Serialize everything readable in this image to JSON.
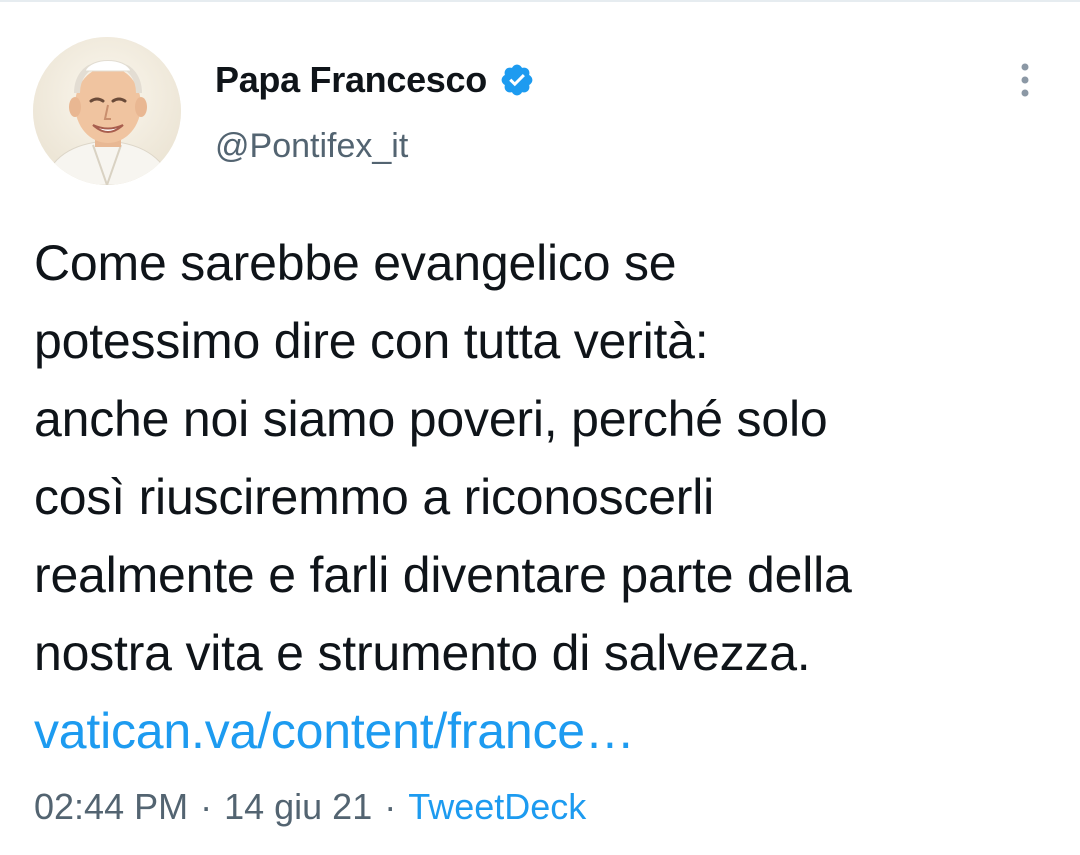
{
  "tweet": {
    "author": {
      "display_name": "Papa Francesco",
      "handle": "@Pontifex_it",
      "verified": true,
      "avatar_icon": "profile-photo"
    },
    "text_lines": [
      "Come sarebbe evangelico se",
      "potessimo dire con tutta verità:",
      "anche noi siamo poveri, perché solo",
      "così riusciremmo a riconoscerli",
      "realmente e farli diventare parte della",
      "nostra vita e strumento di salvezza."
    ],
    "link_text": "vatican.va/content/france…",
    "time": "02:44 PM",
    "separator": "·",
    "date": "14 giu 21",
    "source": "TweetDeck"
  },
  "icons": {
    "verified": "verified-badge-icon",
    "more": "more-vertical-icon"
  },
  "colors": {
    "text": "#0f1419",
    "secondary": "#536471",
    "accent": "#1d9bf0"
  }
}
